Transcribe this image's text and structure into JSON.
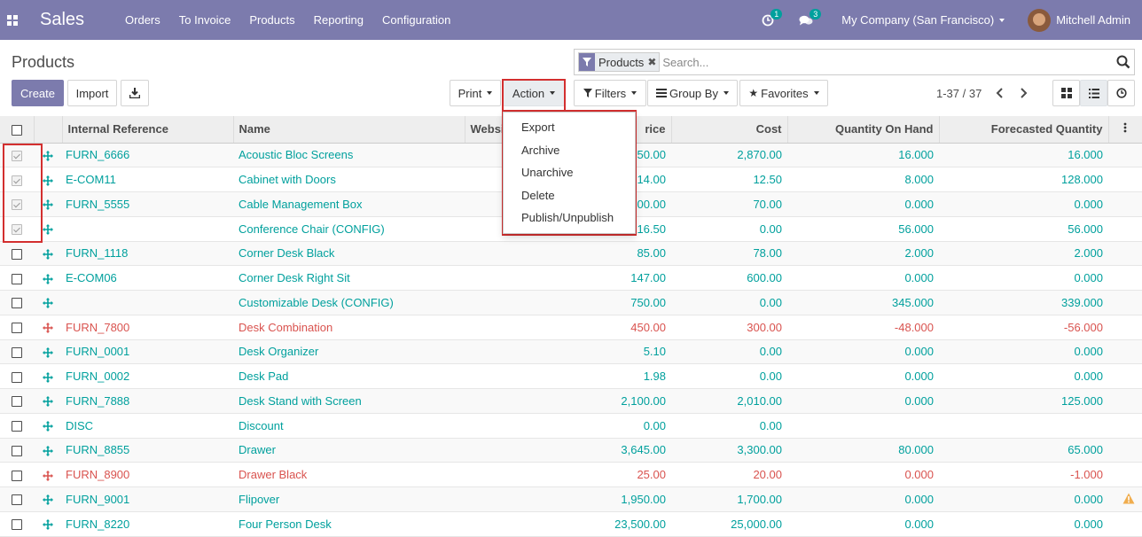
{
  "nav": {
    "app_name": "Sales",
    "menu": [
      "Orders",
      "To Invoice",
      "Products",
      "Reporting",
      "Configuration"
    ],
    "activity_count": "1",
    "message_count": "3",
    "company": "My Company (San Francisco)",
    "user": "Mitchell Admin",
    "brand_color": "#7c7bad"
  },
  "control": {
    "title": "Products",
    "create": "Create",
    "import": "Import",
    "print": "Print",
    "action": "Action",
    "filters": "Filters",
    "group_by": "Group By",
    "favorites": "Favorites",
    "facet": "Products",
    "search_placeholder": "Search...",
    "pager": "1-37 / 37"
  },
  "action_menu": [
    "Export",
    "Archive",
    "Unarchive",
    "Delete",
    "Publish/Unpublish"
  ],
  "columns": [
    "Internal Reference",
    "Name",
    "Websit",
    "rice",
    "Cost",
    "Quantity On Hand",
    "Forecasted Quantity"
  ],
  "rows": [
    {
      "ref": "FURN_6666",
      "name": "Acoustic Bloc Screens",
      "price": "950.00",
      "cost": "2,870.00",
      "qty": "16.000",
      "fc": "16.000",
      "checked": true,
      "red": false
    },
    {
      "ref": "E-COM11",
      "name": "Cabinet with Doors",
      "price": "14.00",
      "cost": "12.50",
      "qty": "8.000",
      "fc": "128.000",
      "checked": true,
      "red": false
    },
    {
      "ref": "FURN_5555",
      "name": "Cable Management Box",
      "price": "100.00",
      "cost": "70.00",
      "qty": "0.000",
      "fc": "0.000",
      "checked": true,
      "red": false
    },
    {
      "ref": "",
      "name": "Conference Chair (CONFIG)",
      "price": "16.50",
      "cost": "0.00",
      "qty": "56.000",
      "fc": "56.000",
      "checked": true,
      "red": false
    },
    {
      "ref": "FURN_1118",
      "name": "Corner Desk Black",
      "price": "85.00",
      "cost": "78.00",
      "qty": "2.000",
      "fc": "2.000",
      "checked": false,
      "red": false
    },
    {
      "ref": "E-COM06",
      "name": "Corner Desk Right Sit",
      "price": "147.00",
      "cost": "600.00",
      "qty": "0.000",
      "fc": "0.000",
      "checked": false,
      "red": false
    },
    {
      "ref": "",
      "name": "Customizable Desk (CONFIG)",
      "price": "750.00",
      "cost": "0.00",
      "qty": "345.000",
      "fc": "339.000",
      "checked": false,
      "red": false
    },
    {
      "ref": "FURN_7800",
      "name": "Desk Combination",
      "price": "450.00",
      "cost": "300.00",
      "qty": "-48.000",
      "fc": "-56.000",
      "checked": false,
      "red": true
    },
    {
      "ref": "FURN_0001",
      "name": "Desk Organizer",
      "price": "5.10",
      "cost": "0.00",
      "qty": "0.000",
      "fc": "0.000",
      "checked": false,
      "red": false
    },
    {
      "ref": "FURN_0002",
      "name": "Desk Pad",
      "price": "1.98",
      "cost": "0.00",
      "qty": "0.000",
      "fc": "0.000",
      "checked": false,
      "red": false
    },
    {
      "ref": "FURN_7888",
      "name": "Desk Stand with Screen",
      "price": "2,100.00",
      "cost": "2,010.00",
      "qty": "0.000",
      "fc": "125.000",
      "checked": false,
      "red": false
    },
    {
      "ref": "DISC",
      "name": "Discount",
      "price": "0.00",
      "cost": "0.00",
      "qty": "",
      "fc": "",
      "checked": false,
      "red": false
    },
    {
      "ref": "FURN_8855",
      "name": "Drawer",
      "price": "3,645.00",
      "cost": "3,300.00",
      "qty": "80.000",
      "fc": "65.000",
      "checked": false,
      "red": false
    },
    {
      "ref": "FURN_8900",
      "name": "Drawer Black",
      "price": "25.00",
      "cost": "20.00",
      "qty": "0.000",
      "fc": "-1.000",
      "checked": false,
      "red": true
    },
    {
      "ref": "FURN_9001",
      "name": "Flipover",
      "price": "1,950.00",
      "cost": "1,700.00",
      "qty": "0.000",
      "fc": "0.000",
      "checked": false,
      "red": false
    },
    {
      "ref": "FURN_8220",
      "name": "Four Person Desk",
      "price": "23,500.00",
      "cost": "25,000.00",
      "qty": "0.000",
      "fc": "0.000",
      "checked": false,
      "red": false
    }
  ]
}
